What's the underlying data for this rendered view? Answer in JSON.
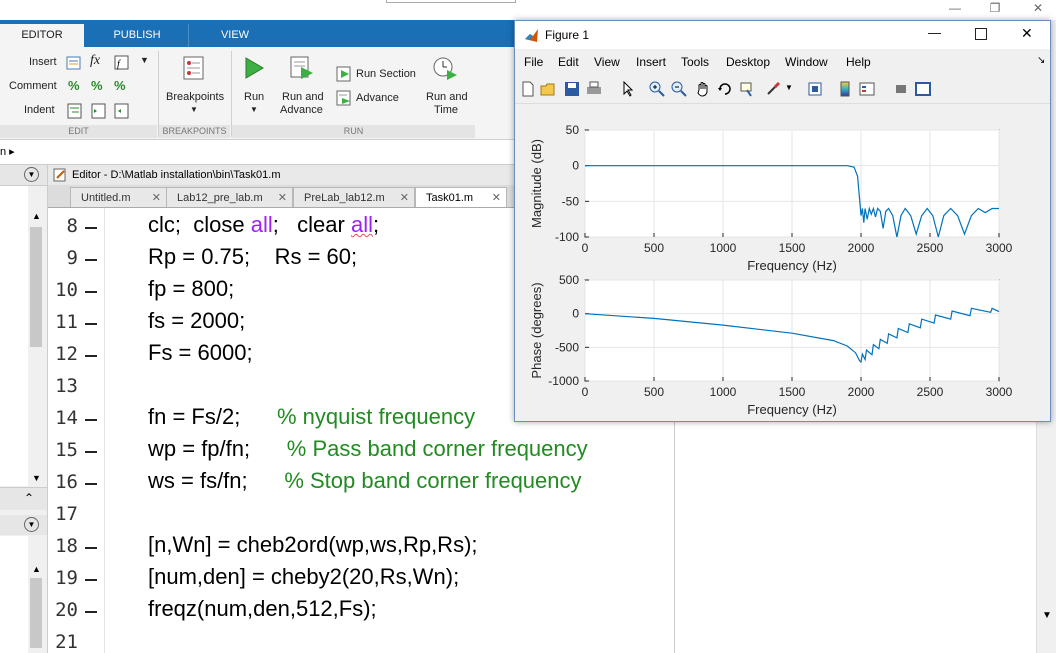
{
  "ribbon": {
    "tabs": [
      "EDITOR",
      "PUBLISH",
      "VIEW"
    ],
    "edit_group": {
      "insert": "Insert",
      "comment": "Comment",
      "indent": "Indent",
      "fx": "fx",
      "label": "EDIT"
    },
    "breakpoints": {
      "button": "Breakpoints",
      "label": "BREAKPOINTS"
    },
    "run": {
      "run": "Run",
      "run_and_advance_1": "Run and",
      "run_and_advance_2": "Advance",
      "run_section": "Run Section",
      "advance": "Advance",
      "run_and_time_1": "Run and",
      "run_and_time_2": "Time",
      "label": "RUN"
    }
  },
  "path_bar": {
    "text": "n ▸"
  },
  "editor": {
    "title": "Editor - D:\\Matlab installation\\bin\\Task01.m",
    "tabs": [
      {
        "label": "Untitled.m"
      },
      {
        "label": "Lab12_pre_lab.m"
      },
      {
        "label": "PreLab_lab12.m"
      },
      {
        "label": "Task01.m"
      }
    ],
    "lines": [
      {
        "num": "8",
        "dash": true,
        "segments": [
          [
            "clc;  close ",
            ""
          ],
          [
            "all",
            "kw"
          ],
          [
            ";   clear ",
            ""
          ],
          [
            "all",
            "kw-squig"
          ],
          [
            ";",
            ""
          ]
        ]
      },
      {
        "num": "9",
        "dash": true,
        "segments": [
          [
            "Rp = 0.75;    Rs = 60;",
            ""
          ]
        ]
      },
      {
        "num": "10",
        "dash": true,
        "segments": [
          [
            "fp = 800;",
            ""
          ]
        ]
      },
      {
        "num": "11",
        "dash": true,
        "segments": [
          [
            "fs = 2000;",
            ""
          ]
        ]
      },
      {
        "num": "12",
        "dash": true,
        "segments": [
          [
            "Fs = 6000;",
            ""
          ]
        ]
      },
      {
        "num": "13",
        "dash": false,
        "segments": []
      },
      {
        "num": "14",
        "dash": true,
        "segments": [
          [
            "fn = Fs/2;      ",
            ""
          ],
          [
            "% nyquist frequency",
            "cm"
          ]
        ]
      },
      {
        "num": "15",
        "dash": true,
        "segments": [
          [
            "wp = fp/fn;      ",
            ""
          ],
          [
            "% Pass band corner frequency",
            "cm"
          ]
        ]
      },
      {
        "num": "16",
        "dash": true,
        "segments": [
          [
            "ws = fs/fn;      ",
            ""
          ],
          [
            "% Stop band corner frequency",
            "cm"
          ]
        ]
      },
      {
        "num": "17",
        "dash": false,
        "segments": []
      },
      {
        "num": "18",
        "dash": true,
        "segments": [
          [
            "[n,Wn] = cheb2ord(wp,ws,Rp,Rs);",
            ""
          ]
        ]
      },
      {
        "num": "19",
        "dash": true,
        "segments": [
          [
            "[num,den] = cheby2(20,Rs,Wn);",
            ""
          ]
        ]
      },
      {
        "num": "20",
        "dash": true,
        "segments": [
          [
            "freqz(num,den,512,Fs);",
            ""
          ]
        ]
      },
      {
        "num": "21",
        "dash": false,
        "segments": []
      }
    ]
  },
  "figure": {
    "title": "Figure 1",
    "menu": [
      "File",
      "Edit",
      "View",
      "Insert",
      "Tools",
      "Desktop",
      "Window",
      "Help"
    ],
    "toolbar_icons": [
      "new-figure-icon",
      "open-icon",
      "save-icon",
      "print-icon",
      "pointer-icon",
      "zoom-in-icon",
      "zoom-out-icon",
      "pan-icon",
      "rotate-icon",
      "data-cursor-icon",
      "brush-icon",
      "link-icon",
      "colorbar-icon",
      "legend-icon",
      "hide-tools-icon",
      "dock-icon"
    ]
  },
  "chart_data": [
    {
      "type": "line",
      "xlabel": "Frequency (Hz)",
      "ylabel": "Magnitude (dB)",
      "xlim": [
        0,
        3000
      ],
      "ylim": [
        -100,
        50
      ],
      "xticks": [
        0,
        500,
        1000,
        1500,
        2000,
        2500,
        3000
      ],
      "yticks": [
        50,
        0,
        -50,
        -100
      ],
      "grid": true,
      "color": "#0072bd",
      "x": [
        0,
        500,
        1000,
        1500,
        1900,
        1950,
        1975,
        2000,
        2010,
        2020,
        2030,
        2045,
        2060,
        2075,
        2090,
        2105,
        2120,
        2140,
        2160,
        2180,
        2200,
        2230,
        2260,
        2290,
        2320,
        2360,
        2400,
        2440,
        2480,
        2520,
        2560,
        2600,
        2650,
        2700,
        2750,
        2800,
        2850,
        2900,
        2950,
        3000
      ],
      "y": [
        0,
        0,
        0,
        0,
        0,
        -2,
        -15,
        -70,
        -60,
        -80,
        -60,
        -75,
        -60,
        -68,
        -60,
        -72,
        -60,
        -64,
        -88,
        -64,
        -60,
        -70,
        -100,
        -70,
        -60,
        -70,
        -96,
        -70,
        -60,
        -70,
        -100,
        -70,
        -60,
        -70,
        -96,
        -70,
        -60,
        -66,
        -60,
        -60
      ]
    },
    {
      "type": "line",
      "xlabel": "Frequency (Hz)",
      "ylabel": "Phase (degrees)",
      "xlim": [
        0,
        3000
      ],
      "ylim": [
        -1000,
        500
      ],
      "xticks": [
        0,
        500,
        1000,
        1500,
        2000,
        2500,
        3000
      ],
      "yticks": [
        500,
        0,
        -500,
        -1000
      ],
      "grid": true,
      "color": "#0072bd",
      "x": [
        0,
        500,
        1000,
        1500,
        1800,
        1900,
        1960,
        1990,
        2000,
        2010,
        2030,
        2040,
        2080,
        2090,
        2130,
        2140,
        2190,
        2200,
        2260,
        2270,
        2340,
        2350,
        2430,
        2440,
        2530,
        2540,
        2650,
        2660,
        2790,
        2800,
        2940,
        2950,
        3000
      ],
      "y": [
        0,
        -70,
        -170,
        -290,
        -400,
        -480,
        -580,
        -700,
        -720,
        -600,
        -680,
        -540,
        -610,
        -460,
        -520,
        -380,
        -440,
        -300,
        -360,
        -220,
        -280,
        -150,
        -210,
        -80,
        -140,
        -20,
        -80,
        40,
        -30,
        80,
        20,
        80,
        30
      ]
    }
  ]
}
